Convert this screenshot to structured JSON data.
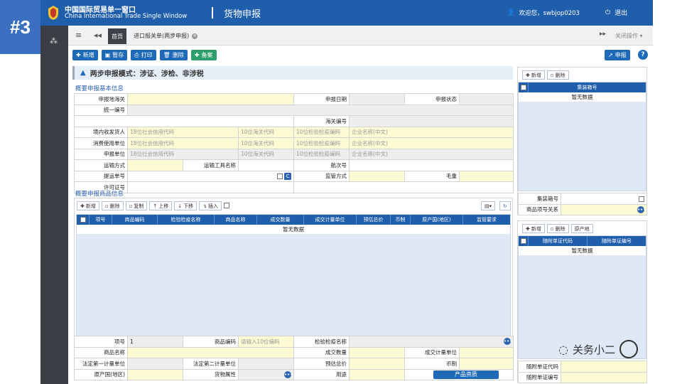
{
  "badge": "#3",
  "header": {
    "brand_cn": "中国国际贸易单一窗口",
    "brand_en": "China International Trade Single Window",
    "app_title": "货物申报",
    "welcome": "欢迎您，swbjop0203",
    "logout": "退出"
  },
  "tabs": {
    "home": "首页",
    "doc": "进口报关单(两步申报)",
    "close_ops": "关闭操作 ▾"
  },
  "toolbar": {
    "new": "新增",
    "draft": "暂存",
    "print": "打印",
    "delete": "删除",
    "filing": "备案",
    "apply": "申报"
  },
  "mode_text": "两步申报模式：涉证、涉检、非涉税",
  "basic": {
    "title": "概要申报基本信息",
    "declare_customs": "申报地海关",
    "declare_date": "申报日期",
    "declare_status": "申报状态",
    "unified_no": "统一编号",
    "customs_no": "海关编号",
    "domestic_consignee": "境内收发货人",
    "consumer_unit": "消费使用单位",
    "declare_unit": "申报单位",
    "ph_credit": "18位社会信用代码",
    "ph_customs_code": "10位海关代码",
    "ph_inspect_code": "10位检验检疫编码",
    "ph_company": "企业名称(中文)",
    "transport_mode": "运输方式",
    "transport_name": "运输工具名称",
    "voyage_no": "航次号",
    "bill_no": "提运单号",
    "supervision": "监管方式",
    "gross_weight": "毛重",
    "license_no": "许可证号"
  },
  "goods": {
    "title": "概要申报商品信息",
    "buttons": {
      "new": "新增",
      "delete": "删除",
      "copy": "复制",
      "up": "上移",
      "down": "下移",
      "insert": "插入"
    },
    "columns": [
      "项号",
      "商品编码",
      "检验检疫名称",
      "商品名称",
      "成交数量",
      "成交计量单位",
      "预估总价",
      "币制",
      "原产国(地区)",
      "监管要求"
    ],
    "empty": "暂无数据",
    "item_no_label": "项号",
    "item_no_value": "1",
    "hs_code": "商品编码",
    "hs_placeholder": "请输入10位编码",
    "inspect_name": "检验检疫名称",
    "goods_name": "商品名称",
    "deal_qty": "成交数量",
    "deal_unit": "成交计量单位",
    "legal_unit1": "法定第一计量单位",
    "legal_unit2": "法定第二计量单位",
    "est_total": "预估总价",
    "currency": "币制",
    "origin": "原产国(地区)",
    "goods_attr": "货物属性",
    "usage": "用途",
    "product_qual": "产品资质"
  },
  "container": {
    "new": "新增",
    "delete": "删除",
    "col": "集装箱号",
    "empty": "暂无数据",
    "no_label": "集装箱号",
    "rel_label": "商品项号关系"
  },
  "attached": {
    "new": "新增",
    "delete": "删除",
    "origin_btn": "原产地",
    "col1": "随附单证代码",
    "col2": "随附单证编号",
    "empty": "暂无数据",
    "code_label": "随附单证代码",
    "no_label": "随附单证编号"
  },
  "watermark": "关务小二"
}
